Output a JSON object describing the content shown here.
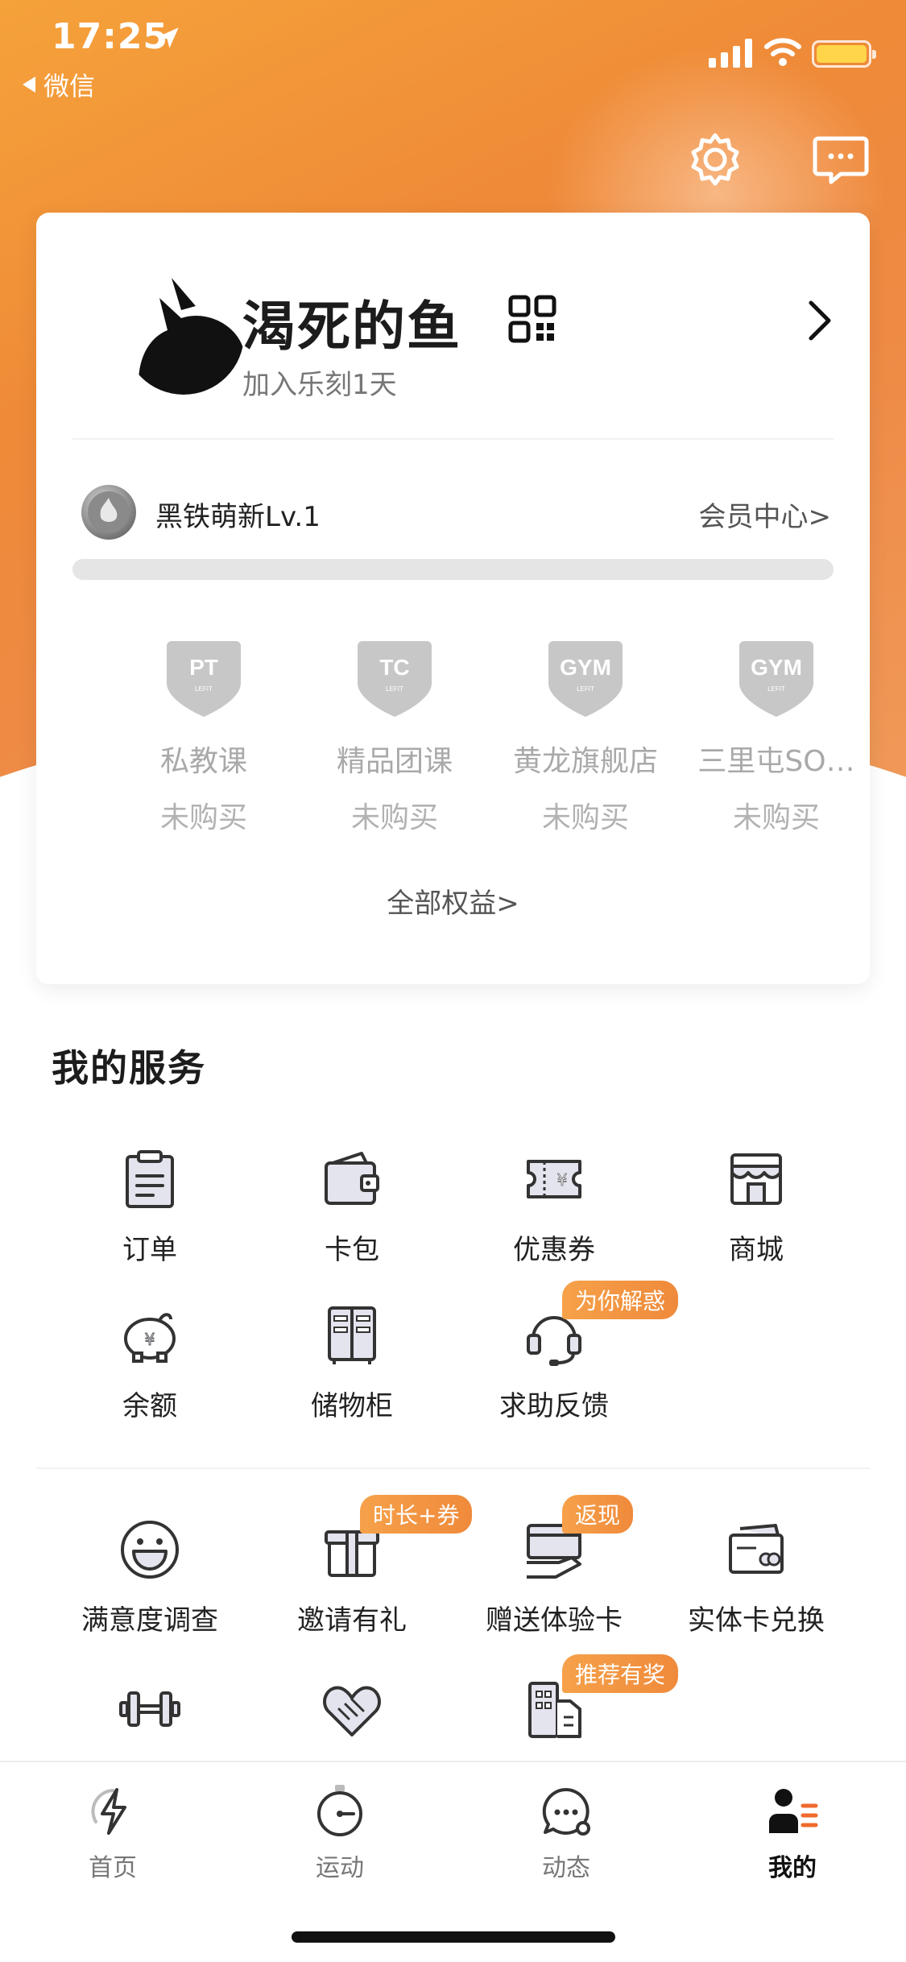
{
  "status_bar": {
    "time": "17:25",
    "back_app": "微信"
  },
  "profile": {
    "username": "渴死的鱼",
    "join_days": "加入乐刻1天",
    "level": "黑铁萌新Lv.1",
    "member_center": "会员中心>",
    "level_progress": 0
  },
  "benefits": {
    "items": [
      {
        "badge": "PT",
        "name": "私教课",
        "status": "未购买"
      },
      {
        "badge": "TC",
        "name": "精品团课",
        "status": "未购买"
      },
      {
        "badge": "GYM",
        "name": "黄龙旗舰店",
        "status": "未购买"
      },
      {
        "badge": "GYM",
        "name": "三里屯SO…",
        "status": "未购买"
      }
    ],
    "badge_sub": "LEFIT",
    "all": "全部权益>"
  },
  "services": {
    "title": "我的服务",
    "items": [
      {
        "label": "订单",
        "icon": "clipboard-icon"
      },
      {
        "label": "卡包",
        "icon": "wallet-icon"
      },
      {
        "label": "优惠券",
        "icon": "coupon-icon"
      },
      {
        "label": "商城",
        "icon": "store-icon"
      },
      {
        "label": "余额",
        "icon": "piggy-bank-icon"
      },
      {
        "label": "储物柜",
        "icon": "locker-icon"
      },
      {
        "label": "求助反馈",
        "icon": "headset-icon",
        "tag": "为你解惑"
      },
      {
        "label": "满意度调查",
        "icon": "smiley-icon"
      },
      {
        "label": "邀请有礼",
        "icon": "gift-icon",
        "tag": "时长+券"
      },
      {
        "label": "赠送体验卡",
        "icon": "card-hand-icon",
        "tag": "返现"
      },
      {
        "label": "实体卡兑换",
        "icon": "physical-card-icon"
      },
      {
        "label": "",
        "icon": "dumbbell-icon"
      },
      {
        "label": "",
        "icon": "handshake-heart-icon"
      },
      {
        "label": "",
        "icon": "building-icon",
        "tag": "推荐有奖"
      }
    ]
  },
  "tabbar": {
    "tabs": [
      {
        "label": "首页",
        "icon": "lightning-icon"
      },
      {
        "label": "运动",
        "icon": "stopwatch-icon"
      },
      {
        "label": "动态",
        "icon": "chat-bubble-icon"
      },
      {
        "label": "我的",
        "icon": "profile-icon",
        "active": true
      }
    ]
  },
  "colors": {
    "accent": "#F08A3A",
    "tag": "#F39A45",
    "muted_text": "#A9A9A9"
  }
}
